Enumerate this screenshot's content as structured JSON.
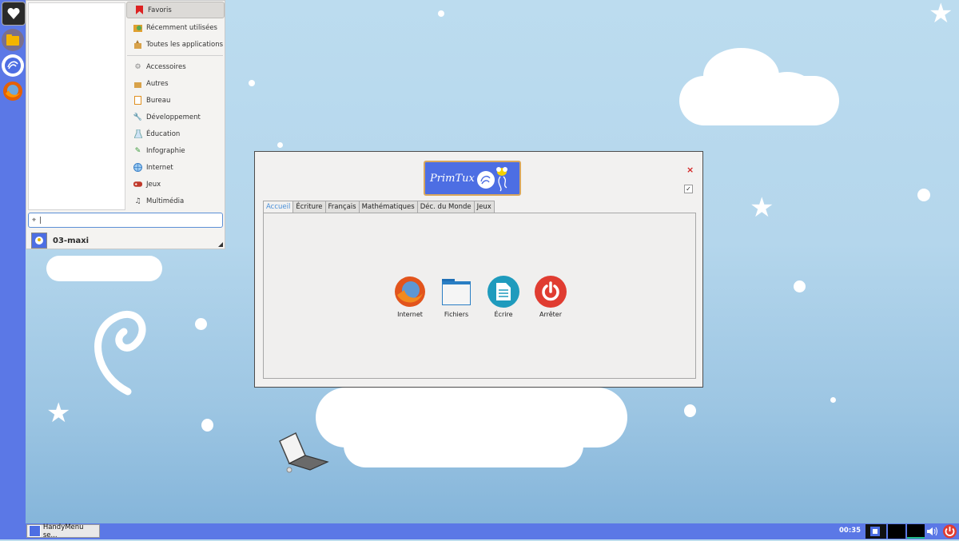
{
  "app_menu": {
    "categories": [
      {
        "label": "Favoris",
        "icon": "bookmark-icon"
      },
      {
        "label": "Récemment utilisées",
        "icon": "recent-icon"
      },
      {
        "label": "Toutes les applications",
        "icon": "all-apps-icon"
      },
      {
        "label": "Accessoires",
        "icon": "accessories-icon"
      },
      {
        "label": "Autres",
        "icon": "others-icon"
      },
      {
        "label": "Bureau",
        "icon": "office-icon"
      },
      {
        "label": "Développement",
        "icon": "wrench-icon"
      },
      {
        "label": "Éducation",
        "icon": "education-icon"
      },
      {
        "label": "Infographie",
        "icon": "graphics-icon"
      },
      {
        "label": "Internet",
        "icon": "globe-icon"
      },
      {
        "label": "Jeux",
        "icon": "gamepad-icon"
      },
      {
        "label": "Multimédia",
        "icon": "music-icon"
      }
    ],
    "search_value": "|",
    "user_name": "03-maxi"
  },
  "handymenu": {
    "logo_text": "PrimTux",
    "close_symbol": "×",
    "keep_open_symbol": "✓",
    "tabs": [
      "Accueil",
      "Écriture",
      "Français",
      "Mathématiques",
      "Déc. du Monde",
      "Jeux"
    ],
    "launchers": [
      {
        "label": "Internet",
        "icon": "firefox-icon"
      },
      {
        "label": "Fichiers",
        "icon": "folder-icon"
      },
      {
        "label": "Écrire",
        "icon": "document-icon"
      },
      {
        "label": "Arrêter",
        "icon": "power-icon"
      }
    ]
  },
  "taskbar": {
    "task_label": "HandyMenu se...",
    "clock": "00:35"
  },
  "colors": {
    "panel": "#5b78e6",
    "accent_tab": "#4a90d9",
    "close": "#d32222",
    "power": "#e03c31"
  }
}
